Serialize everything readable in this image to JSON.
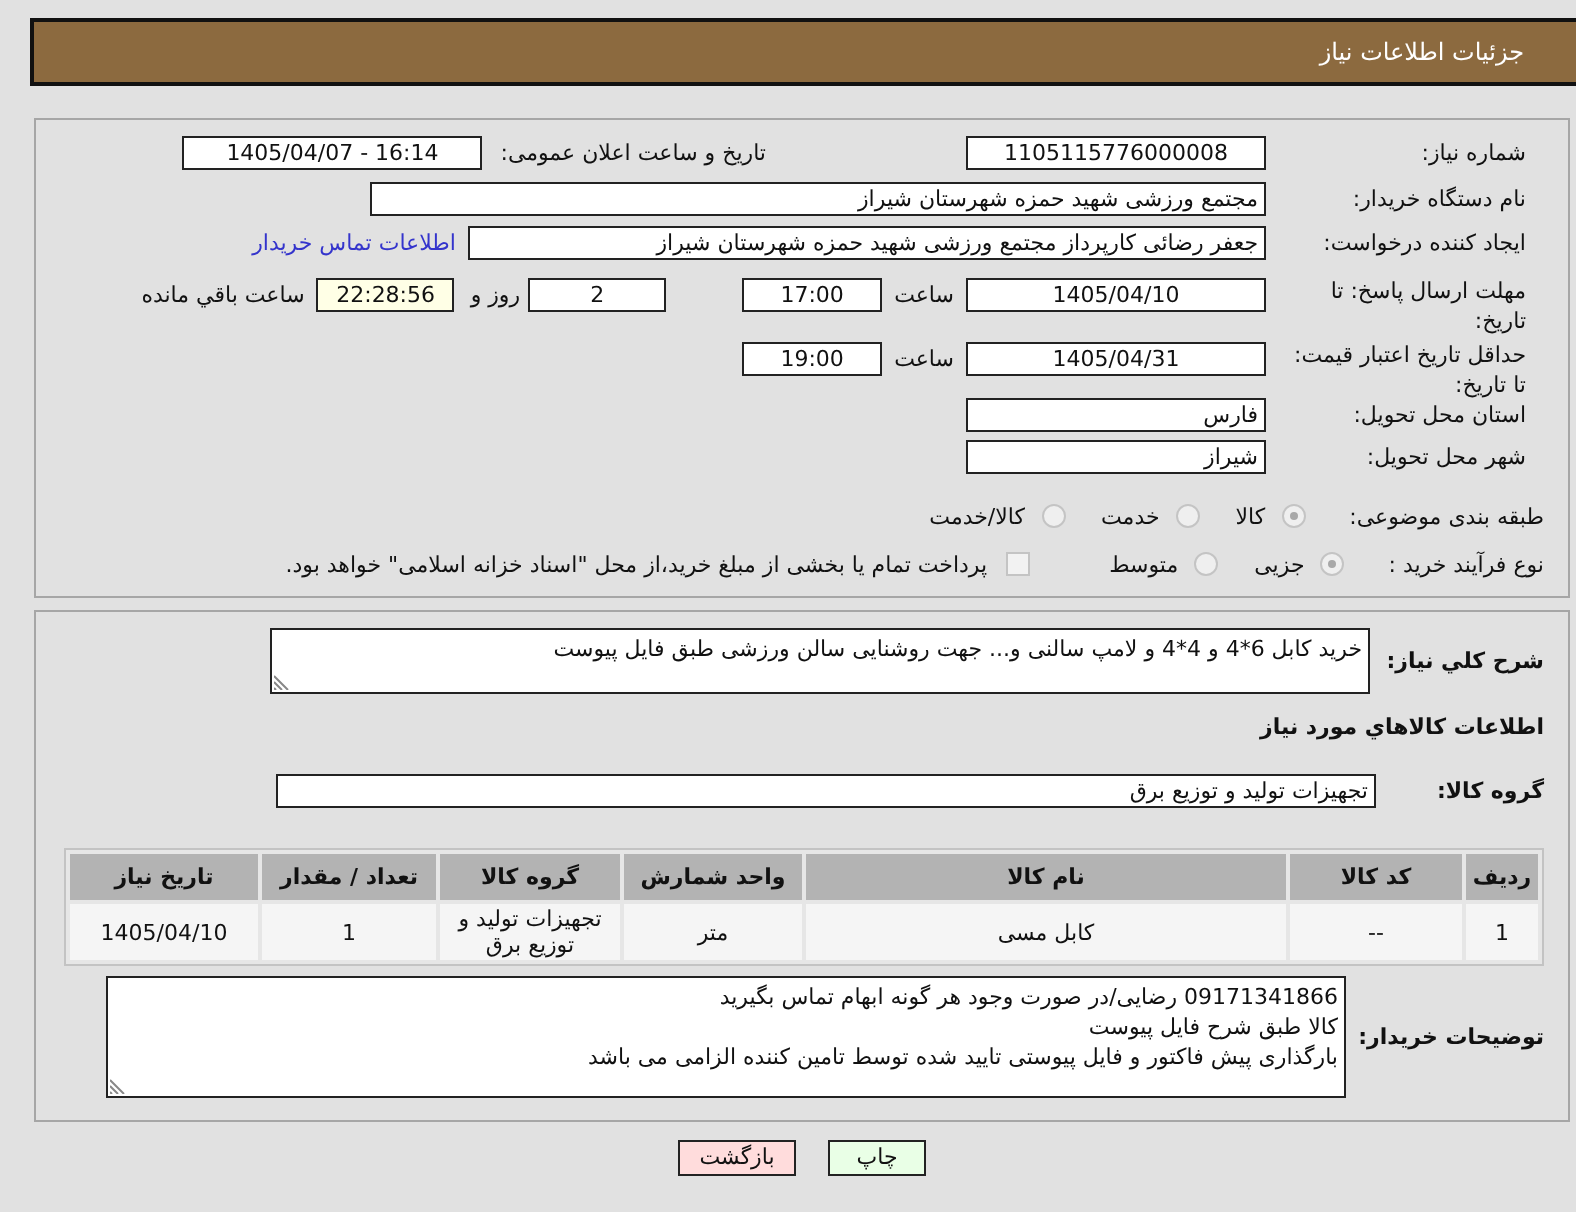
{
  "header": {
    "title": "جزئیات اطلاعات نیاز"
  },
  "details": {
    "need_number": {
      "label": "شماره نیاز:",
      "value": "1105115776000008"
    },
    "announcement": {
      "label": "تاریخ و ساعت اعلان عمومی:",
      "value": "1405/04/07 - 16:14"
    },
    "buyer_org": {
      "label": "نام دستگاه خریدار:",
      "value": "مجتمع ورزشی شهید حمزه شهرستان شیراز"
    },
    "requester": {
      "label": "ایجاد کننده درخواست:",
      "value": "جعفر رضائی کارپرداز مجتمع ورزشی شهید حمزه شهرستان شیراز",
      "link": "اطلاعات تماس خریدار"
    },
    "response_deadline": {
      "label": "مهلت ارسال پاسخ: تا تاریخ:",
      "date": "1405/04/10",
      "time_label": "ساعت",
      "time": "17:00",
      "days": "2",
      "days_label": "روز و",
      "remaining": "22:28:56",
      "remaining_label": "ساعت باقي مانده"
    },
    "price_validity": {
      "label": "حداقل تاریخ اعتبار قیمت: تا تاریخ:",
      "date": "1405/04/31",
      "time_label": "ساعت",
      "time": "19:00"
    },
    "province": {
      "label": "استان محل تحویل:",
      "value": "فارس"
    },
    "city": {
      "label": "شهر محل تحویل:",
      "value": "شیراز"
    },
    "category": {
      "label": "طبقه بندی موضوعی:",
      "options": [
        {
          "label": "کالا",
          "selected": true
        },
        {
          "label": "خدمت",
          "selected": false
        },
        {
          "label": "کالا/خدمت",
          "selected": false
        }
      ]
    },
    "purchase_type": {
      "label": "نوع فرآیند خرید :",
      "options": [
        {
          "label": "جزیی",
          "selected": true
        },
        {
          "label": "متوسط",
          "selected": false
        }
      ],
      "treasury": {
        "label": "پرداخت تمام یا بخشی از مبلغ خرید،از محل \"اسناد خزانه اسلامی\" خواهد بود.",
        "checked": false
      }
    }
  },
  "description": {
    "label": "شرح کلي نیاز:",
    "value": "خرید کابل 6*4 و 4*4 و لامپ سالنی و... جهت روشنایی سالن ورزشی طبق فایل پیوست"
  },
  "goods": {
    "title": "اطلاعات کالاهاي مورد نیاز",
    "group_label": "گروه کالا:",
    "group_value": "تجهیزات تولید و توزیع برق",
    "columns": [
      "ردیف",
      "کد کالا",
      "نام کالا",
      "واحد شمارش",
      "گروه کالا",
      "تعداد / مقدار",
      "تاریخ نیاز"
    ],
    "rows": [
      [
        "1",
        "--",
        "کابل مسی",
        "متر",
        "تجهیزات تولید و توزیع برق",
        "1",
        "1405/04/10"
      ]
    ]
  },
  "buyer_notes": {
    "label": "توضیحات خریدار:",
    "lines": [
      "09171341866 رضایی/در صورت وجود هر گونه ابهام تماس بگیرید",
      "کالا طبق شرح فایل پیوست",
      "بارگذاری پیش فاکتور و فایل پیوستی تایید شده توسط تامین کننده الزامی می باشد"
    ]
  },
  "buttons": [
    {
      "label": "چاپ",
      "kind": "print"
    },
    {
      "label": "بازگشت",
      "kind": "back"
    }
  ]
}
